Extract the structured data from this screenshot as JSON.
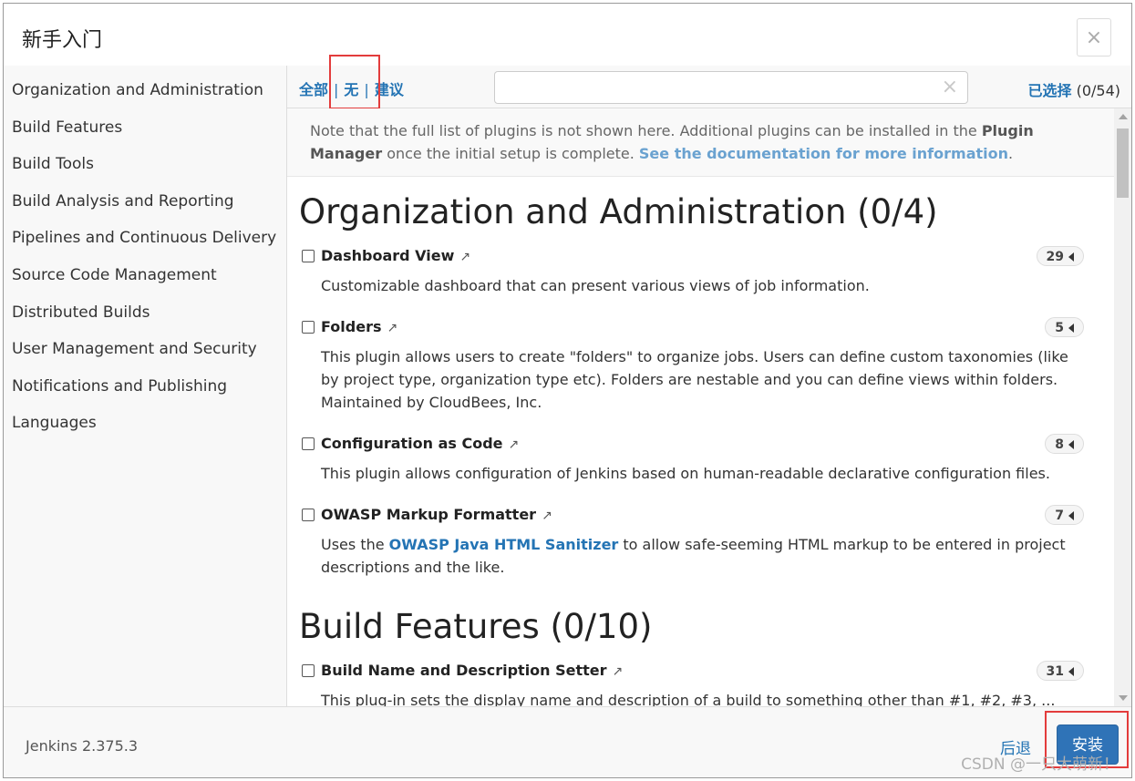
{
  "dialog": {
    "title": "新手入门",
    "close_glyph": "×"
  },
  "sidebar": {
    "items": [
      {
        "label": "Organization and Administration"
      },
      {
        "label": "Build Features"
      },
      {
        "label": "Build Tools"
      },
      {
        "label": "Build Analysis and Reporting"
      },
      {
        "label": "Pipelines and Continuous Delivery"
      },
      {
        "label": "Source Code Management"
      },
      {
        "label": "Distributed Builds"
      },
      {
        "label": "User Management and Security"
      },
      {
        "label": "Notifications and Publishing"
      },
      {
        "label": "Languages"
      }
    ]
  },
  "toolbar": {
    "filter_all": "全部",
    "filter_none": "无",
    "filter_suggested": "建议",
    "separator": "|",
    "search_placeholder": "",
    "search_value": "",
    "clear_glyph": "×",
    "selected_label": "已选择",
    "selected_count": "(0/54)"
  },
  "note": {
    "text_before": "Note that the full list of plugins is not shown here. Additional plugins can be installed in the ",
    "plugin_manager": "Plugin Manager",
    "text_middle": " once the initial setup is complete. ",
    "doc_link": "See the documentation for more information",
    "text_after": "."
  },
  "categories": [
    {
      "heading": "Organization and Administration (0/4)",
      "plugins": [
        {
          "name": "Dashboard View",
          "deps": "29",
          "desc": "Customizable dashboard that can present various views of job information."
        },
        {
          "name": "Folders",
          "deps": "5",
          "desc": "This plugin allows users to create \"folders\" to organize jobs. Users can define custom taxonomies (like by project type, organization type etc). Folders are nestable and you can define views within folders. Maintained by CloudBees, Inc."
        },
        {
          "name": "Configuration as Code",
          "deps": "8",
          "desc": "This plugin allows configuration of Jenkins based on human-readable declarative configuration files."
        },
        {
          "name": "OWASP Markup Formatter",
          "deps": "7",
          "desc_before": "Uses the ",
          "desc_link": "OWASP Java HTML Sanitizer",
          "desc_after": " to allow safe-seeming HTML markup to be entered in project descriptions and the like."
        }
      ]
    },
    {
      "heading": "Build Features (0/10)",
      "plugins": [
        {
          "name": "Build Name and Description Setter",
          "deps": "31",
          "desc": "This plug-in sets the display name and description of a build to something other than #1, #2, #3, ..."
        }
      ]
    }
  ],
  "footer": {
    "version": "Jenkins 2.375.3",
    "back_label": "后退",
    "install_label": "安装"
  },
  "watermark": "CSDN @一只大萌新！",
  "icons": {
    "external_link": "↗",
    "checkbox": "checkbox-unchecked-icon"
  },
  "colors": {
    "link": "#2474b4",
    "primary_button": "#2f73b7",
    "highlight_box": "#e33c3c"
  }
}
